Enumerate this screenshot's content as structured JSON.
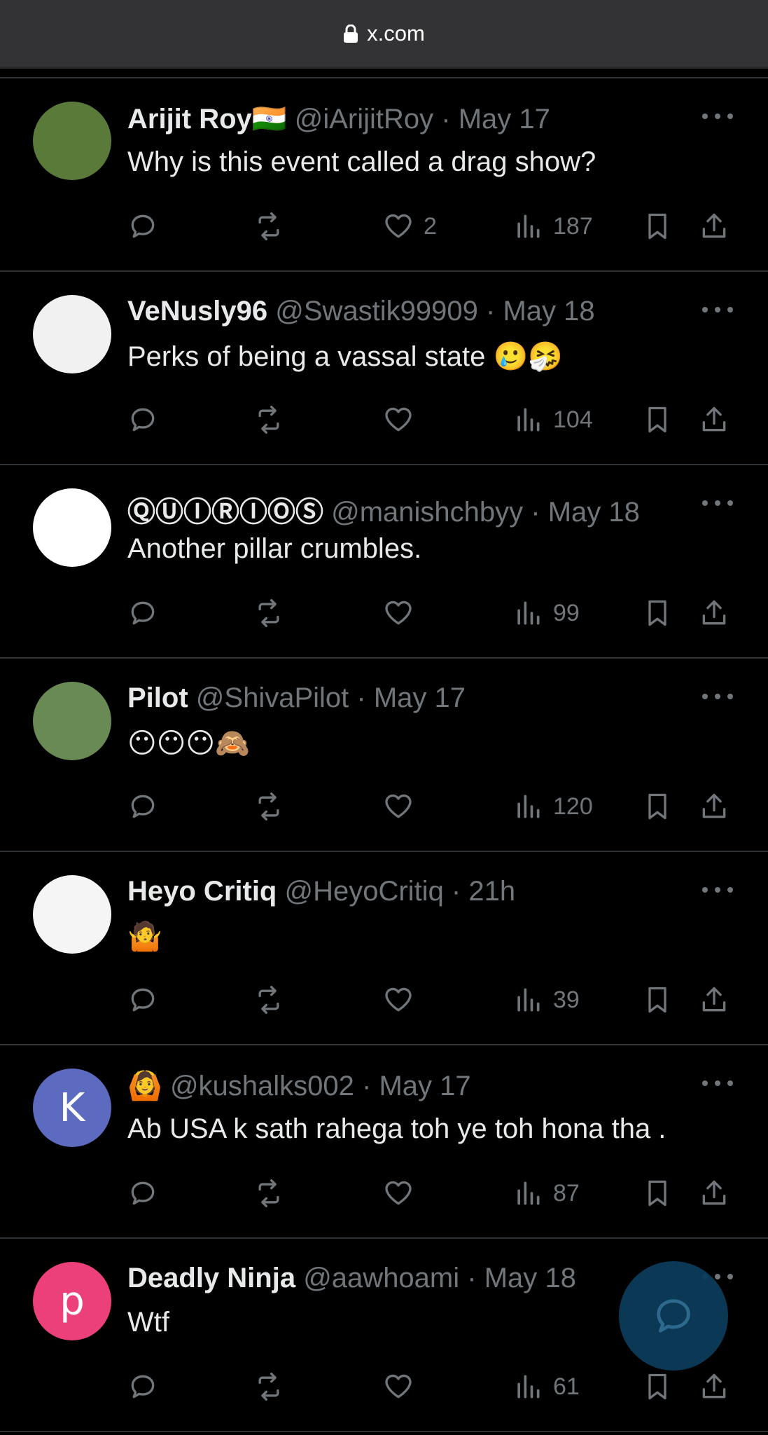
{
  "browser": {
    "domain": "x.com"
  },
  "tweets": [
    {
      "name": "Arijit Roy🇮🇳",
      "handle": "@iArijitRoy",
      "date": "May 17",
      "text": "Why is this event called a drag show?",
      "likes": "2",
      "views": "187",
      "avatar_color": "#5a7a3a",
      "avatar_letter": ""
    },
    {
      "name": "VeNusly96",
      "handle": "@Swastik99909",
      "date": "May 18",
      "text": "Perks of being a vassal state 🥲🤧",
      "likes": "",
      "views": "104",
      "avatar_color": "#f1f1f1",
      "avatar_letter": ""
    },
    {
      "name": "ⓆⓊⒾⓇⒾⓄⓈ",
      "handle": "@manishchbyy",
      "date": "May 18",
      "text": "Another pillar crumbles.",
      "likes": "",
      "views": "99",
      "avatar_color": "#ffffff",
      "avatar_letter": ""
    },
    {
      "name": "Pilot",
      "handle": "@ShivaPilot",
      "date": "May 17",
      "text": "😶😶😶🙈",
      "likes": "",
      "views": "120",
      "avatar_color": "#6a8a55",
      "avatar_letter": ""
    },
    {
      "name": "Heyo Critiq",
      "handle": "@HeyoCritiq",
      "date": "21h",
      "text": "🤷",
      "likes": "",
      "views": "39",
      "avatar_color": "#f5f5f5",
      "avatar_letter": ""
    },
    {
      "name": "🙆",
      "handle": "@kushalks002",
      "date": "May 17",
      "text": "Ab USA k sath rahega toh ye toh hona tha .",
      "likes": "",
      "views": "87",
      "avatar_color": "#5c6bc0",
      "avatar_letter": "K"
    },
    {
      "name": "Deadly Ninja",
      "handle": "@aawhoami",
      "date": "May 18",
      "text": "Wtf",
      "likes": "",
      "views": "61",
      "avatar_color": "#ec407a",
      "avatar_letter": "p"
    }
  ],
  "colors": {
    "background": "#000000",
    "text": "#e7e9ea",
    "muted": "#71767b",
    "fab": "#0c3c5a"
  }
}
